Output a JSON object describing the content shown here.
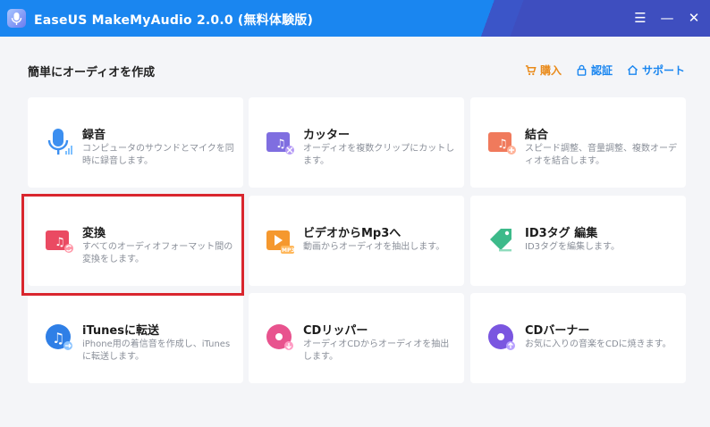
{
  "window": {
    "title": "EaseUS MakeMyAudio 2.0.0 (無料体験版)",
    "menu_glyph": "☰",
    "minimize_glyph": "—",
    "close_glyph": "✕"
  },
  "header": {
    "page_title": "簡単にオーディオを作成",
    "links": [
      {
        "label": "購入",
        "icon": "cart-icon"
      },
      {
        "label": "認証",
        "icon": "lock-icon"
      },
      {
        "label": "サポート",
        "icon": "home-icon"
      }
    ]
  },
  "cards": [
    {
      "name": "録音",
      "desc": "コンピュータのサウンドとマイクを同時に録音します。",
      "icon": "microphone-icon"
    },
    {
      "name": "カッター",
      "desc": "オーディオを複数クリップにカットします。",
      "icon": "cutter-icon"
    },
    {
      "name": "結合",
      "desc": "スピード調整、音量調整、複数オーディオを結合します。",
      "icon": "merge-icon"
    },
    {
      "name": "変換",
      "desc": "すべてのオーディオフォーマット間の変換をします。",
      "icon": "convert-icon"
    },
    {
      "name": "ビデオからMp3へ",
      "desc": "動画からオーディオを抽出します。",
      "icon": "video-to-mp3-icon",
      "badge": "MP3"
    },
    {
      "name": "ID3タグ 編集",
      "desc": "ID3タグを編集します。",
      "icon": "tag-icon"
    },
    {
      "name": "iTunesに転送",
      "desc": "iPhone用の着信音を作成し、iTunesに転送します。",
      "icon": "itunes-icon"
    },
    {
      "name": "CDリッパー",
      "desc": "オーディオCDからオーディオを抽出します。",
      "icon": "cd-ripper-icon"
    },
    {
      "name": "CDバーナー",
      "desc": "お気に入りの音楽をCDに焼きます。",
      "icon": "cd-burner-icon"
    }
  ],
  "colors": {
    "titlebar": "#1a86f0",
    "accent_orange": "#e98a1a",
    "highlight_red": "#d9262e"
  }
}
